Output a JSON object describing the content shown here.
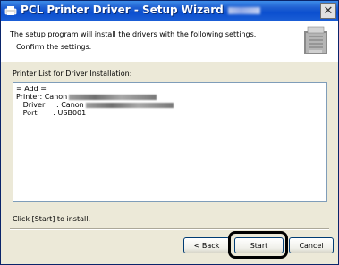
{
  "window": {
    "title": "PCL Printer Driver - Setup Wizard",
    "close_label": "✕"
  },
  "header": {
    "line1": "The setup program will install the drivers with the following settings.",
    "line2": "Confirm the settings."
  },
  "printer_list": {
    "label": "Printer List for Driver Installation:",
    "lines": [
      "= Add =",
      "Printer: Canon",
      "   Driver     : Canon",
      "   Port       : USB001"
    ]
  },
  "hint": "Click [Start] to install.",
  "buttons": {
    "back": "< Back",
    "start": "Start",
    "cancel": "Cancel"
  },
  "colors": {
    "titlebar": "#0b4fcf",
    "dialog_bg": "#ece9d8"
  }
}
